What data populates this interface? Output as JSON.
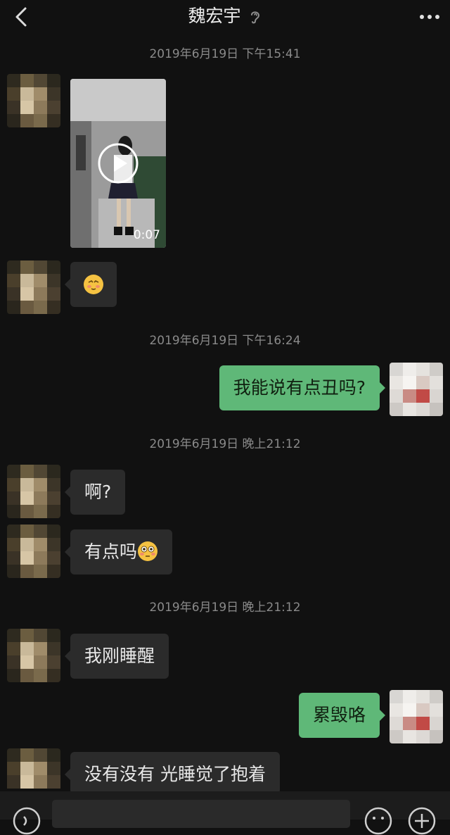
{
  "header": {
    "title": "魏宏宇",
    "back_icon": "chevron-left-icon",
    "ear_icon": "ear-icon",
    "more_icon": "more-icon"
  },
  "messages": {
    "ts1": "2019年6月19日 下午15:41",
    "video_duration": "0:07",
    "ts2": "2019年6月19日 下午16:24",
    "m_right1": "我能说有点丑吗?",
    "ts3": "2019年6月19日 晚上21:12",
    "m_left1": "啊?",
    "m_left2": "有点吗",
    "ts4": "2019年6月19日 晚上21:12",
    "m_left3": "我刚睡醒",
    "m_right2": "累毁咯",
    "m_left4": "没有没有 光睡觉了抱着"
  },
  "colors": {
    "background": "#111111",
    "received_bubble": "#2b2b2b",
    "sent_bubble": "#5fb878",
    "timestamp": "#8a8a8a"
  },
  "icons": {
    "voice": "voice-icon",
    "emoji": "emoji-icon",
    "plus": "plus-icon"
  }
}
